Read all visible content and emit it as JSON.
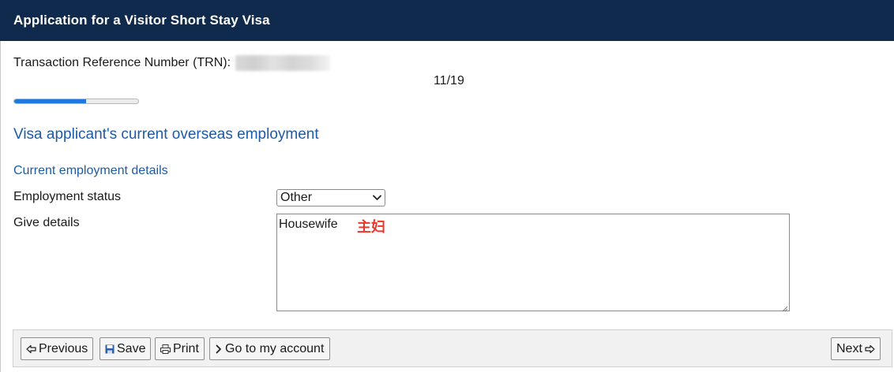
{
  "header": {
    "title": "Application for a Visitor Short Stay Visa"
  },
  "trn": {
    "label": "Transaction Reference Number (TRN):"
  },
  "progress": {
    "step_text": "11/19",
    "fraction": 0.579
  },
  "section": {
    "heading": "Visa applicant's current overseas employment"
  },
  "employment": {
    "subheading": "Current employment details",
    "status_label": "Employment status",
    "status_value": "Other",
    "details_label": "Give details",
    "details_value": "Housewife",
    "annotation": "主妇"
  },
  "toolbar": {
    "previous": "Previous",
    "save": "Save",
    "print": "Print",
    "account": "Go to my account",
    "next": "Next"
  },
  "colors": {
    "header_bg": "#0f2a4c",
    "accent_blue": "#1d5ba8",
    "progress_fill": "#1e78e0",
    "annotation_red": "#e8372b"
  },
  "icons": {
    "previous": "arrow-left-outline-icon",
    "save": "floppy-disk-icon",
    "print": "printer-icon",
    "account": "chevron-right-icon",
    "next": "arrow-right-outline-icon",
    "select": "chevron-down-icon"
  }
}
